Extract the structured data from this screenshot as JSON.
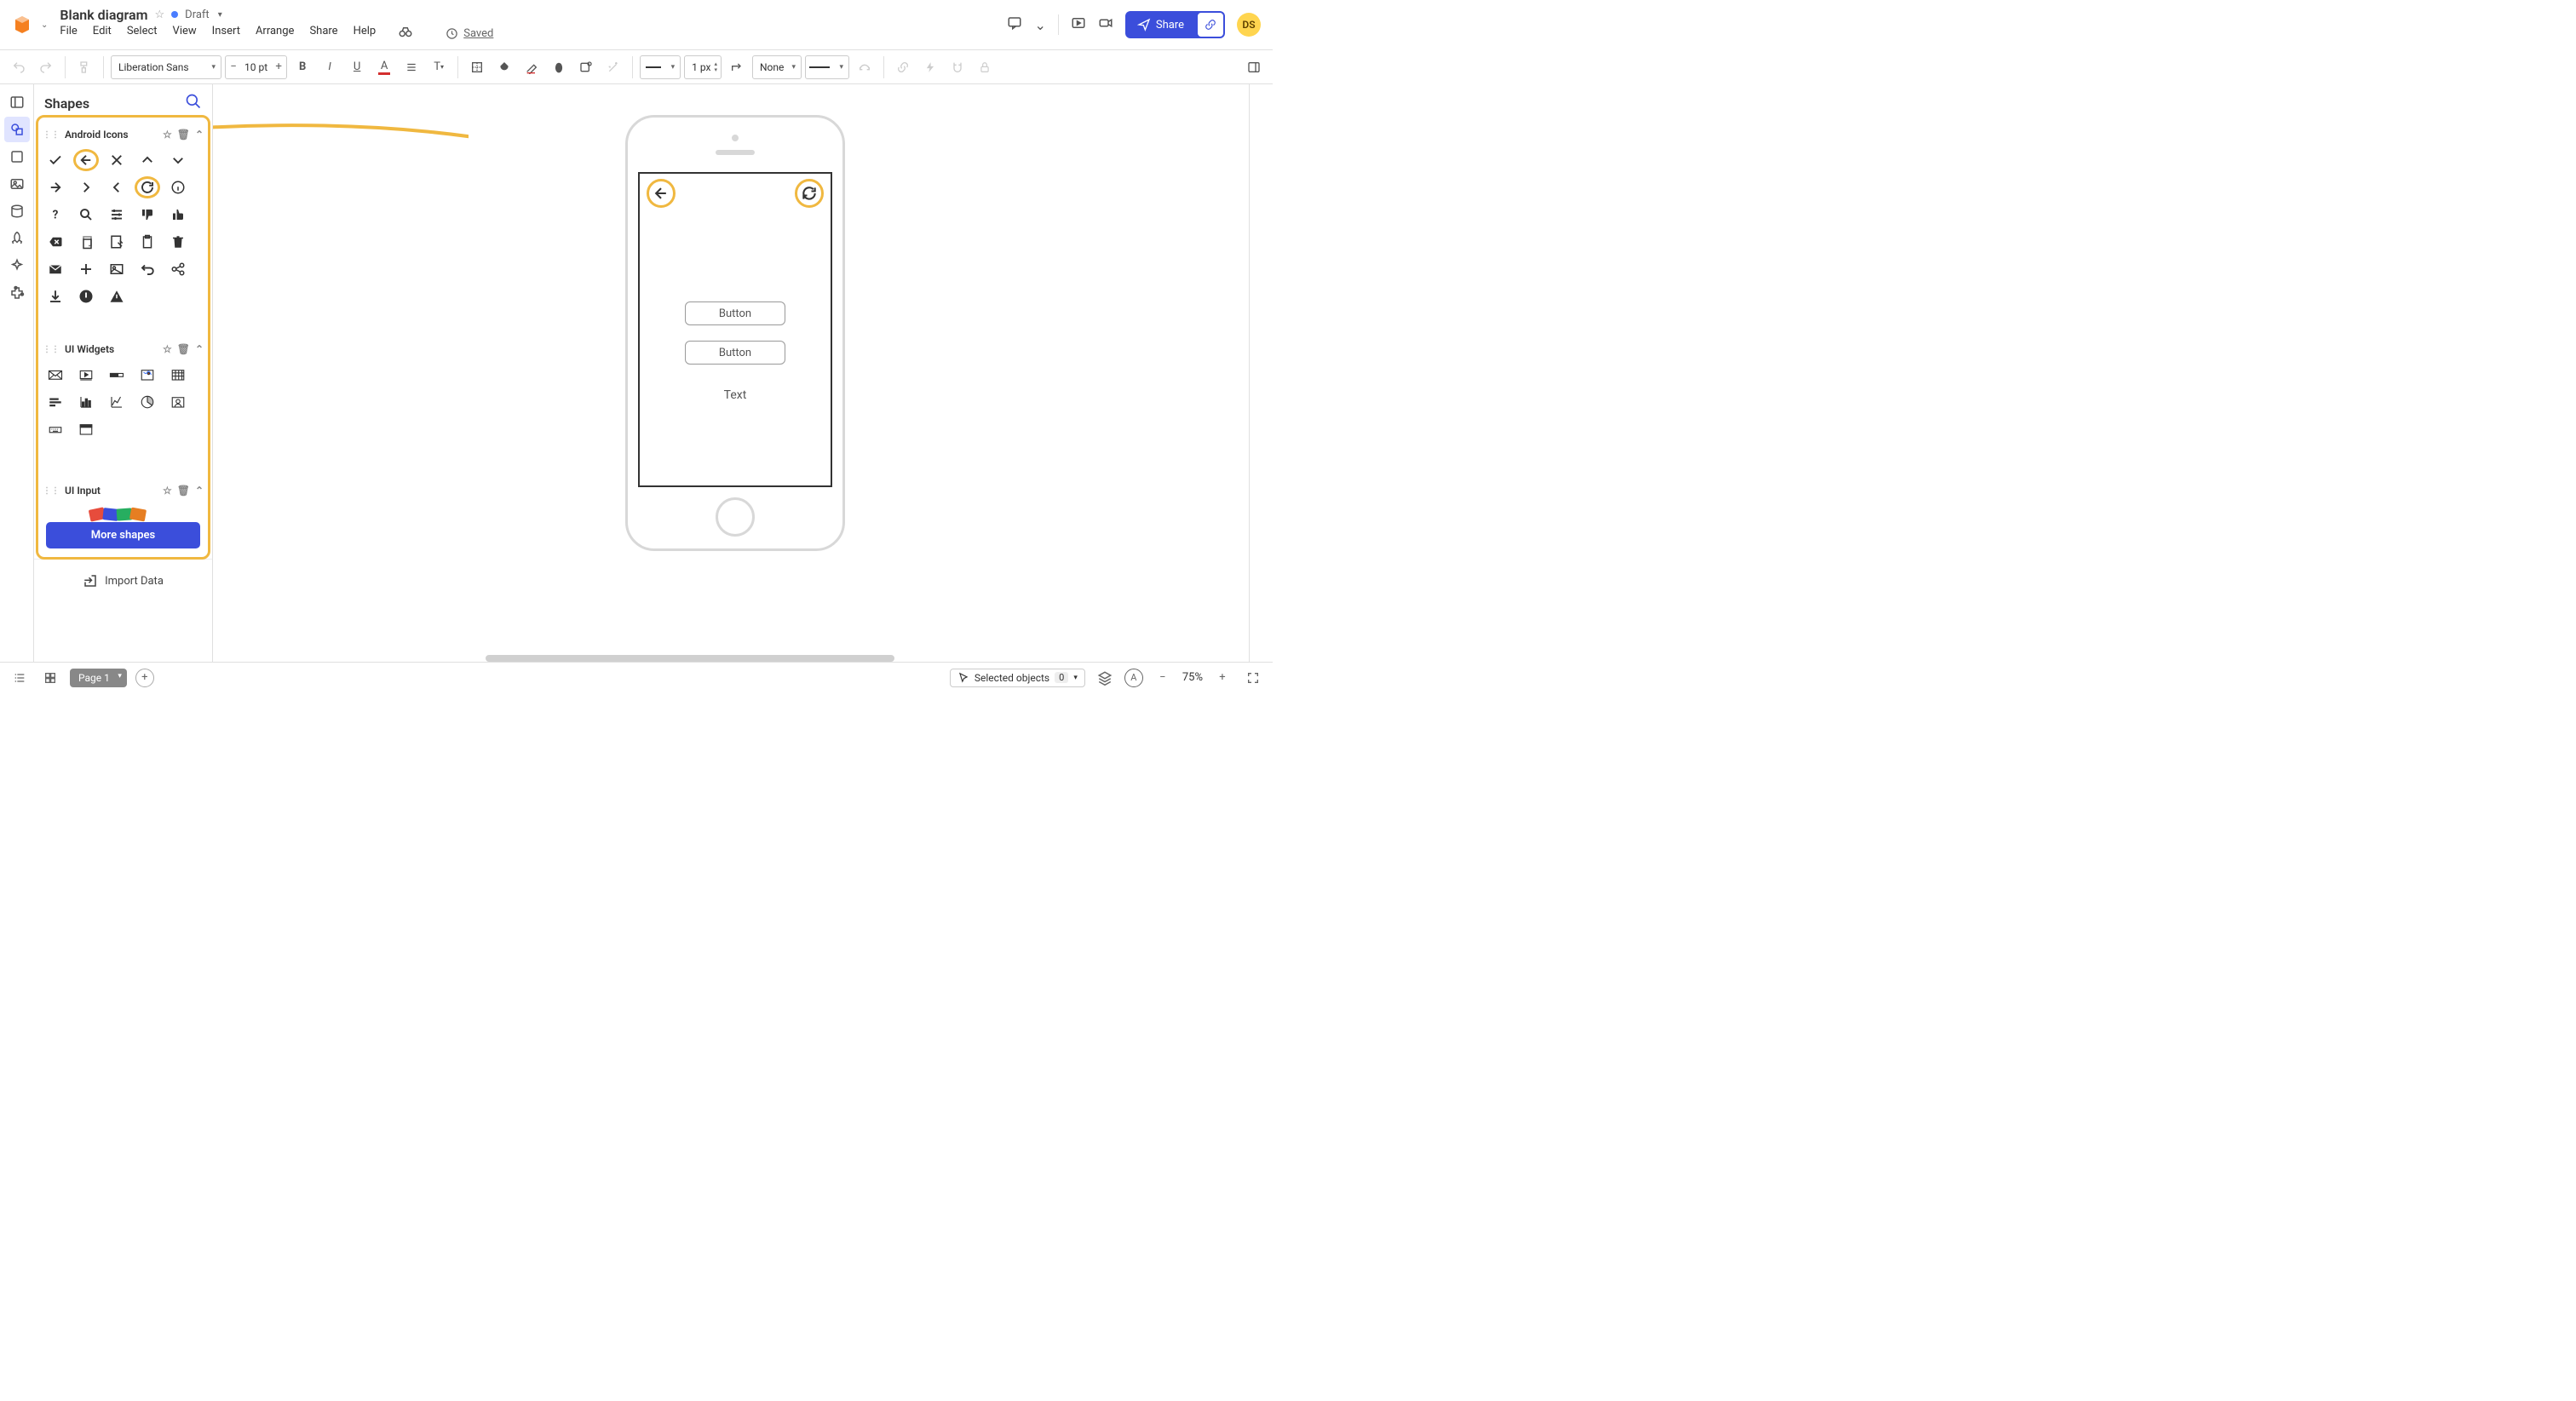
{
  "header": {
    "docTitle": "Blank diagram",
    "draftLabel": "Draft",
    "savedLabel": "Saved",
    "shareLabel": "Share",
    "avatar": "DS",
    "menus": [
      "File",
      "Edit",
      "Select",
      "View",
      "Insert",
      "Arrange",
      "Share",
      "Help"
    ]
  },
  "toolbar": {
    "fontFamily": "Liberation Sans",
    "fontSize": "10 pt",
    "lineWidth": "1 px",
    "lineStyleLabel": "None"
  },
  "shapes": {
    "title": "Shapes",
    "moreShapes": "More shapes",
    "importData": "Import Data",
    "sections": {
      "androidIcons": "Android Icons",
      "uiWidgets": "UI Widgets",
      "uiInput": "UI Input"
    }
  },
  "canvas": {
    "button1": "Button",
    "button2": "Button",
    "text": "Text"
  },
  "bottom": {
    "pageLabel": "Page 1",
    "selectedLabel": "Selected objects",
    "selectedCount": "0",
    "zoom": "75%"
  }
}
